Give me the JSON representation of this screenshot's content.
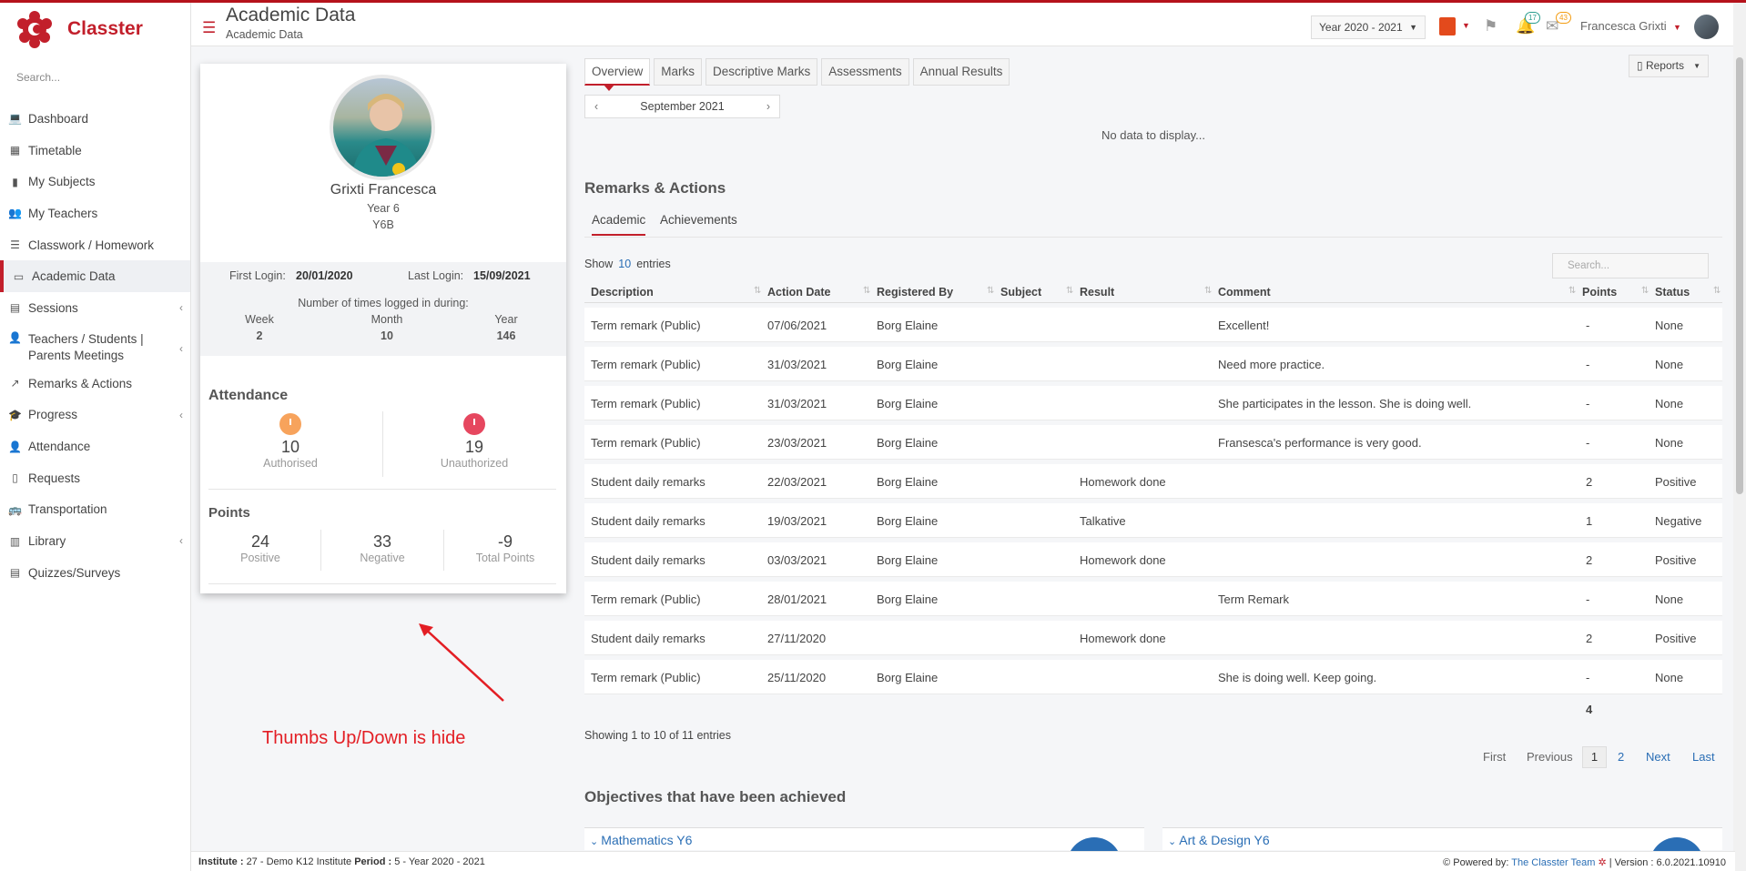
{
  "app": {
    "name": "Classter",
    "search_placeholder": "Search..."
  },
  "sidebar": {
    "items": [
      {
        "label": "Dashboard"
      },
      {
        "label": "Timetable"
      },
      {
        "label": "My Subjects"
      },
      {
        "label": "My Teachers"
      },
      {
        "label": "Classwork / Homework"
      },
      {
        "label": "Academic Data"
      },
      {
        "label": "Sessions"
      },
      {
        "label": "Teachers / Students | Parents Meetings"
      },
      {
        "label": "Remarks & Actions"
      },
      {
        "label": "Progress"
      },
      {
        "label": "Attendance"
      },
      {
        "label": "Requests"
      },
      {
        "label": "Transportation"
      },
      {
        "label": "Library"
      },
      {
        "label": "Quizzes/Surveys"
      }
    ]
  },
  "header": {
    "title": "Academic Data",
    "subtitle": "Academic Data",
    "year": "Year 2020 - 2021",
    "notif_count": "17",
    "msg_count": "43",
    "user": "Francesca Grixti"
  },
  "profile": {
    "name": "Grixti Francesca",
    "year": "Year 6",
    "class": "Y6B",
    "first_login_label": "First Login:",
    "first_login": "20/01/2020",
    "last_login_label": "Last Login:",
    "last_login": "15/09/2021",
    "times_label": "Number of times logged in during:",
    "week_label": "Week",
    "week": "2",
    "month_label": "Month",
    "month": "10",
    "year_label": "Year",
    "year_count": "146",
    "attendance_title": "Attendance",
    "authorised": "10",
    "authorised_label": "Authorised",
    "unauthorized": "19",
    "unauthorized_label": "Unauthorized",
    "points_title": "Points",
    "positive": "24",
    "positive_label": "Positive",
    "negative": "33",
    "negative_label": "Negative",
    "total": "-9",
    "total_label": "Total Points",
    "annotation": "Thumbs Up/Down is hide",
    "colors": {
      "authorised": "#f7a35c",
      "unauthorized": "#e6475f",
      "annotation": "#e31e24"
    }
  },
  "main": {
    "tabs": [
      "Overview",
      "Marks",
      "Descriptive Marks",
      "Assessments",
      "Annual Results"
    ],
    "reports_label": "Reports",
    "month": "September 2021",
    "no_data": "No data to display...",
    "remarks_title": "Remarks & Actions",
    "subtabs": [
      "Academic",
      "Achievements"
    ],
    "show_label": "Show",
    "show_count": "10",
    "entries_label": "entries",
    "table_search": "Search...",
    "columns": [
      "Description",
      "Action Date",
      "Registered By",
      "Subject",
      "Result",
      "Comment",
      "Points",
      "Status"
    ],
    "rows": [
      [
        "Term remark (Public)",
        "07/06/2021",
        "Borg Elaine",
        "",
        "",
        "Excellent!",
        "-",
        "None"
      ],
      [
        "Term remark (Public)",
        "31/03/2021",
        "Borg Elaine",
        "",
        "",
        "Need more practice.",
        "-",
        "None"
      ],
      [
        "Term remark (Public)",
        "31/03/2021",
        "Borg Elaine",
        "",
        "",
        "She participates in the lesson. She is doing well.",
        "-",
        "None"
      ],
      [
        "Term remark (Public)",
        "23/03/2021",
        "Borg Elaine",
        "",
        "",
        "Fransesca's performance is very good.",
        "-",
        "None"
      ],
      [
        "Student daily remarks",
        "22/03/2021",
        "Borg Elaine",
        "",
        "Homework done",
        "",
        "2",
        "Positive"
      ],
      [
        "Student daily remarks",
        "19/03/2021",
        "Borg Elaine",
        "",
        "Talkative",
        "",
        "1",
        "Negative"
      ],
      [
        "Student daily remarks",
        "03/03/2021",
        "Borg Elaine",
        "",
        "Homework done",
        "",
        "2",
        "Positive"
      ],
      [
        "Term remark (Public)",
        "28/01/2021",
        "Borg Elaine",
        "",
        "",
        "Term Remark",
        "-",
        "None"
      ],
      [
        "Student daily remarks",
        "27/11/2020",
        "",
        "",
        "Homework done",
        "",
        "2",
        "Positive"
      ],
      [
        "Term remark (Public)",
        "25/11/2020",
        "Borg Elaine",
        "",
        "",
        "She is doing well. Keep going.",
        "-",
        "None"
      ]
    ],
    "points_total": "4",
    "showing": "Showing 1 to 10 of 11 entries",
    "pager": {
      "first": "First",
      "previous": "Previous",
      "current": "1",
      "page2": "2",
      "next": "Next",
      "last": "Last"
    },
    "objectives_title": "Objectives that have been achieved",
    "objectives": [
      "Mathematics Y6",
      "Art & Design Y6"
    ]
  },
  "footer": {
    "institute_label": "Institute :",
    "institute": "27 - Demo K12 Institute",
    "period_label": "Period :",
    "period": "5 - Year 2020 - 2021",
    "powered_label": "Powered by:",
    "powered": "The Classter Team",
    "version": "| Version : 6.0.2021.10910"
  }
}
